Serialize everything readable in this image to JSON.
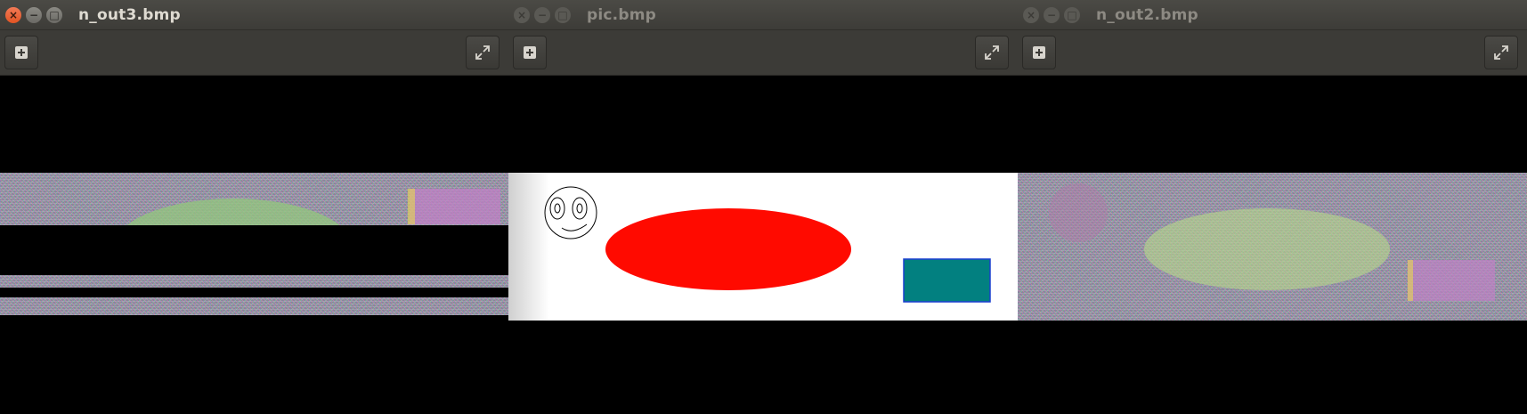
{
  "windows": [
    {
      "title": "n_out3.bmp",
      "state": "active",
      "controls": {
        "close": "×",
        "minimize": "−",
        "maximize": "□"
      },
      "toolbar": {
        "left_icon": "plus-square-icon",
        "right_icon": "fullscreen-icon"
      }
    },
    {
      "title": "pic.bmp",
      "state": "inactive",
      "controls": {
        "close": "×",
        "minimize": "−",
        "maximize": "□"
      },
      "toolbar": {
        "left_icon": "plus-square-icon",
        "right_icon": "fullscreen-icon"
      }
    },
    {
      "title": "n_out2.bmp",
      "state": "inactive",
      "controls": {
        "close": "×",
        "minimize": "−",
        "maximize": "□"
      },
      "toolbar": {
        "left_icon": "plus-square-icon",
        "right_icon": "fullscreen-icon"
      }
    }
  ],
  "colors": {
    "titlebar": "#3d3c38",
    "toolbar": "#3c3b37",
    "close_active": "#e25423",
    "canvas_bg": "#000000",
    "ellipse_red": "#ff0a00",
    "rect_teal": "#028080",
    "rect_border": "#1a3fd0",
    "noise_gray": "#8b8b8b",
    "noise_green": "#93c77d",
    "noise_pink": "#c27fc7"
  }
}
